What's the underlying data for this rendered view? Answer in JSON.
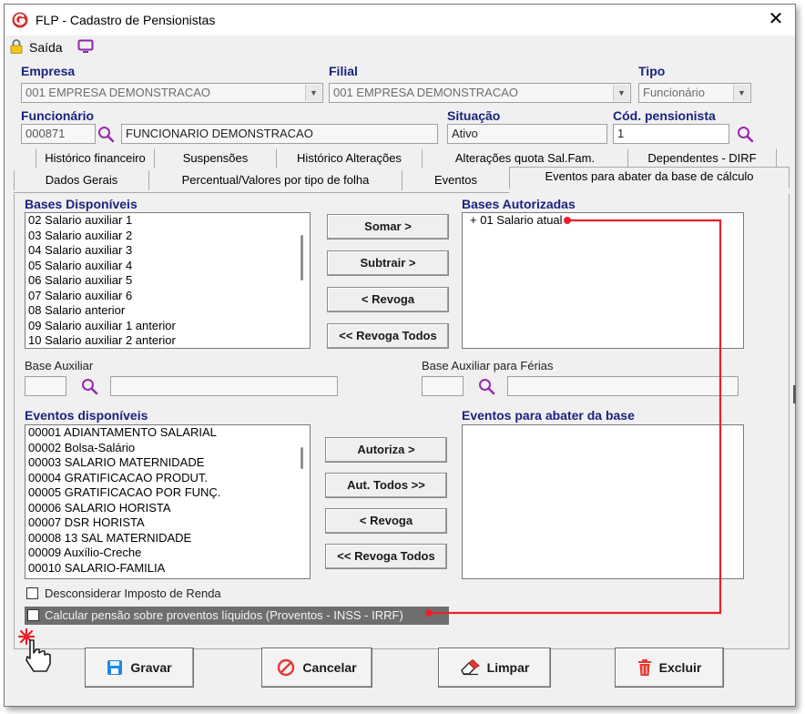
{
  "window": {
    "title": "FLP - Cadastro de Pensionistas",
    "close_symbol": "✕"
  },
  "toolbar": {
    "saida_label": "Saída"
  },
  "labels": {
    "empresa": "Empresa",
    "filial": "Filial",
    "tipo": "Tipo",
    "funcionario": "Funcionário",
    "situacao": "Situação",
    "cod_pensionista": "Cód. pensionista"
  },
  "form": {
    "empresa": "001 EMPRESA DEMONSTRACAO",
    "filial": "001 EMPRESA DEMONSTRACAO",
    "tipo": "Funcionário",
    "funcionario_code": "000871",
    "funcionario_name": "FUNCIONARIO DEMONSTRACAO",
    "situacao": "Ativo",
    "cod_pensionista": "1"
  },
  "tabs_row1": [
    "Histórico financeiro",
    "Suspensões",
    "Histórico Alterações",
    "Alterações quota Sal.Fam.",
    "Dependentes - DIRF"
  ],
  "tabs_row2": [
    "Dados Gerais",
    "Percentual/Valores por tipo de folha",
    "Eventos",
    "Eventos para abater da base de cálculo"
  ],
  "bases": {
    "disponiveis_title": "Bases Disponíveis",
    "autorizadas_title": "Bases Autorizadas",
    "disponiveis": [
      "02 Salario auxiliar 1",
      "03 Salario auxiliar 2",
      "04 Salario auxiliar 3",
      "05 Salario auxiliar 4",
      "06 Salario auxiliar 5",
      "07 Salario auxiliar 6",
      "08 Salario anterior",
      "09 Salario auxiliar 1 anterior",
      "10 Salario auxiliar 2 anterior"
    ],
    "autorizadas": [
      "+ 01 Salario atual"
    ],
    "buttons": {
      "somar": "Somar >",
      "subtrair": "Subtrair >",
      "revoga": "< Revoga",
      "revoga_todos": "<< Revoga Todos"
    }
  },
  "base_auxiliar": {
    "label": "Base Auxiliar",
    "ferias_label": "Base Auxiliar para Férias"
  },
  "eventos": {
    "disponiveis_title": "Eventos disponíveis",
    "abater_title": "Eventos para abater da base",
    "disponiveis": [
      "00001 ADIANTAMENTO SALARIAL",
      "00002 Bolsa-Salário",
      "00003 SALARIO MATERNIDADE",
      "00004 GRATIFICACAO PRODUT.",
      "00005 GRATIFICACAO POR FUNÇ.",
      "00006 SALARIO HORISTA",
      "00007 DSR HORISTA",
      "00008 13 SAL MATERNIDADE",
      "00009 Auxílio-Creche",
      "00010 SALARIO-FAMILIA"
    ],
    "buttons": {
      "autoriza": "Autoriza >",
      "aut_todos": "Aut. Todos >>",
      "revoga": "< Revoga",
      "revoga_todos": "<< Revoga Todos"
    }
  },
  "checks": {
    "desconsiderar_ir": "Desconsiderar Imposto de Renda",
    "calcular_pensao": "Calcular pensão sobre proventos líquidos (Proventos - INSS - IRRF)"
  },
  "footer": {
    "gravar": "Gravar",
    "cancelar": "Cancelar",
    "limpar": "Limpar",
    "excluir": "Excluir"
  },
  "colors": {
    "label_blue": "#1a237e",
    "annotation_red": "#e8202a",
    "app_red": "#d32f2f"
  }
}
